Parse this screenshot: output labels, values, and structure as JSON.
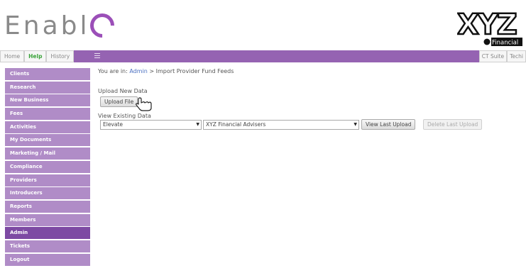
{
  "header": {
    "logo_text": "Enabl",
    "brand": {
      "big": "XYZ",
      "small": "Financial"
    }
  },
  "nav": {
    "tabs": [
      {
        "label": "Home"
      },
      {
        "label": "Help"
      },
      {
        "label": "History"
      }
    ],
    "right_tabs": [
      {
        "label": "CT Suite"
      },
      {
        "label": "Techi"
      }
    ]
  },
  "sidebar": {
    "items": [
      {
        "label": "Clients"
      },
      {
        "label": "Research"
      },
      {
        "label": "New Business"
      },
      {
        "label": "Fees"
      },
      {
        "label": "Activities"
      },
      {
        "label": "My Documents"
      },
      {
        "label": "Marketing / Mail"
      },
      {
        "label": "Compliance"
      },
      {
        "label": "Providers"
      },
      {
        "label": "Introducers"
      },
      {
        "label": "Reports"
      },
      {
        "label": "Members"
      },
      {
        "label": "Admin"
      },
      {
        "label": "Tickets"
      },
      {
        "label": "Logout"
      }
    ],
    "active": "Admin"
  },
  "main": {
    "breadcrumb": {
      "prefix": "You are in:",
      "link": "Admin",
      "separator": ">",
      "current": "Import Provider Fund Feeds"
    },
    "upload": {
      "label": "Upload New Data",
      "button": "Upload File"
    },
    "view": {
      "label": "View Existing Data",
      "provider_select": "Elevate",
      "adviser_select": "XYZ Financial Advisers",
      "view_button": "View Last Upload",
      "delete_button": "Delete Last Upload"
    }
  },
  "colors": {
    "accent": "#9563b2",
    "sidebar": "#b08cc7",
    "sidebar_active": "#7d4aa3",
    "link": "#4a6fc1",
    "help": "#3aa33a"
  }
}
